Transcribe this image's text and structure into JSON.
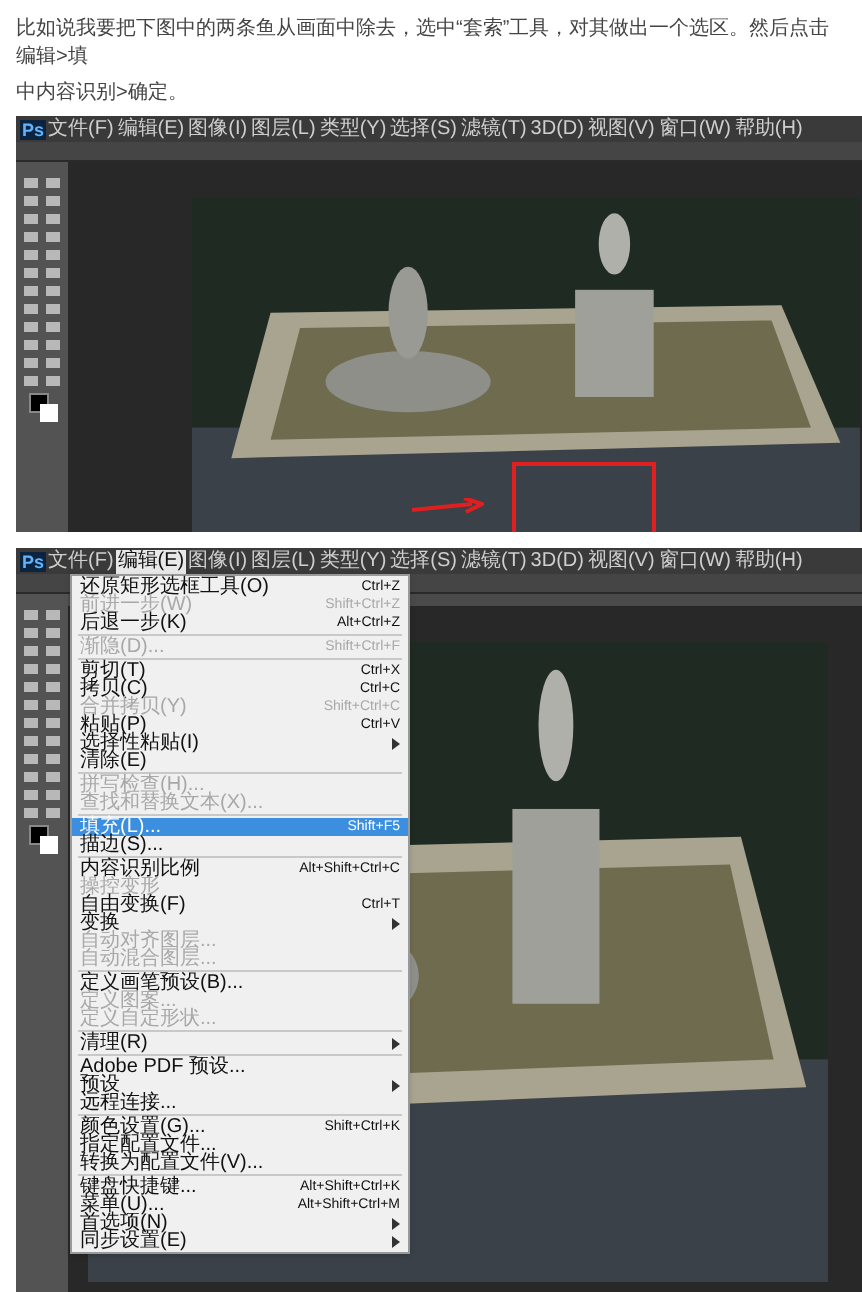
{
  "intro_lines": [
    "比如说我要把下图中的两条鱼从画面中除去，选中“套索”工具，对其做出一个选区。然后点击编辑>填",
    "中内容识别>确定。"
  ],
  "screenshots": [
    {
      "logo": "Ps",
      "menubar": [
        {
          "label": "文件(F)",
          "selected": false
        },
        {
          "label": "编辑(E)",
          "selected": false
        },
        {
          "label": "图像(I)",
          "selected": false
        },
        {
          "label": "图层(L)",
          "selected": false
        },
        {
          "label": "类型(Y)",
          "selected": false
        },
        {
          "label": "选择(S)",
          "selected": false
        },
        {
          "label": "滤镜(T)",
          "selected": false
        },
        {
          "label": "3D(D)",
          "selected": false
        },
        {
          "label": "视图(V)",
          "selected": false
        },
        {
          "label": "窗口(W)",
          "selected": false
        },
        {
          "label": "帮助(H)",
          "selected": false
        }
      ]
    },
    {
      "logo": "Ps",
      "menubar": [
        {
          "label": "文件(F)",
          "selected": false
        },
        {
          "label": "编辑(E)",
          "selected": true
        },
        {
          "label": "图像(I)",
          "selected": false
        },
        {
          "label": "图层(L)",
          "selected": false
        },
        {
          "label": "类型(Y)",
          "selected": false
        },
        {
          "label": "选择(S)",
          "selected": false
        },
        {
          "label": "滤镜(T)",
          "selected": false
        },
        {
          "label": "3D(D)",
          "selected": false
        },
        {
          "label": "视图(V)",
          "selected": false
        },
        {
          "label": "窗口(W)",
          "selected": false
        },
        {
          "label": "帮助(H)",
          "selected": false
        }
      ],
      "edit_menu": [
        {
          "items": [
            {
              "label": "还原矩形选框工具(O)",
              "shortcut": "Ctrl+Z",
              "disabled": false,
              "selected": false,
              "submenu": false
            },
            {
              "label": "前进一步(W)",
              "shortcut": "Shift+Ctrl+Z",
              "disabled": true,
              "selected": false,
              "submenu": false
            },
            {
              "label": "后退一步(K)",
              "shortcut": "Alt+Ctrl+Z",
              "disabled": false,
              "selected": false,
              "submenu": false
            }
          ]
        },
        {
          "items": [
            {
              "label": "渐隐(D)...",
              "shortcut": "Shift+Ctrl+F",
              "disabled": true,
              "selected": false,
              "submenu": false
            }
          ]
        },
        {
          "items": [
            {
              "label": "剪切(T)",
              "shortcut": "Ctrl+X",
              "disabled": false,
              "selected": false,
              "submenu": false
            },
            {
              "label": "拷贝(C)",
              "shortcut": "Ctrl+C",
              "disabled": false,
              "selected": false,
              "submenu": false
            },
            {
              "label": "合并拷贝(Y)",
              "shortcut": "Shift+Ctrl+C",
              "disabled": true,
              "selected": false,
              "submenu": false
            },
            {
              "label": "粘贴(P)",
              "shortcut": "Ctrl+V",
              "disabled": false,
              "selected": false,
              "submenu": false
            },
            {
              "label": "选择性粘贴(I)",
              "disabled": false,
              "selected": false,
              "submenu": true
            },
            {
              "label": "清除(E)",
              "disabled": false,
              "selected": false,
              "submenu": false
            }
          ]
        },
        {
          "items": [
            {
              "label": "拼写检查(H)...",
              "disabled": true,
              "selected": false,
              "submenu": false
            },
            {
              "label": "查找和替换文本(X)...",
              "disabled": true,
              "selected": false,
              "submenu": false
            }
          ]
        },
        {
          "items": [
            {
              "label": "填充(L)...",
              "shortcut": "Shift+F5",
              "disabled": false,
              "selected": true,
              "submenu": false
            },
            {
              "label": "描边(S)...",
              "disabled": false,
              "selected": false,
              "submenu": false
            }
          ]
        },
        {
          "items": [
            {
              "label": "内容识别比例",
              "shortcut": "Alt+Shift+Ctrl+C",
              "disabled": false,
              "selected": false,
              "submenu": false
            },
            {
              "label": "操控变形",
              "disabled": true,
              "selected": false,
              "submenu": false
            },
            {
              "label": "自由变换(F)",
              "shortcut": "Ctrl+T",
              "disabled": false,
              "selected": false,
              "submenu": false
            },
            {
              "label": "变换",
              "disabled": false,
              "selected": false,
              "submenu": true
            },
            {
              "label": "自动对齐图层...",
              "disabled": true,
              "selected": false,
              "submenu": false
            },
            {
              "label": "自动混合图层...",
              "disabled": true,
              "selected": false,
              "submenu": false
            }
          ]
        },
        {
          "items": [
            {
              "label": "定义画笔预设(B)...",
              "disabled": false,
              "selected": false,
              "submenu": false
            },
            {
              "label": "定义图案...",
              "disabled": true,
              "selected": false,
              "submenu": false
            },
            {
              "label": "定义自定形状...",
              "disabled": true,
              "selected": false,
              "submenu": false
            }
          ]
        },
        {
          "items": [
            {
              "label": "清理(R)",
              "disabled": false,
              "selected": false,
              "submenu": true
            }
          ]
        },
        {
          "items": [
            {
              "label": "Adobe PDF 预设...",
              "disabled": false,
              "selected": false,
              "submenu": false
            },
            {
              "label": "预设",
              "disabled": false,
              "selected": false,
              "submenu": true
            },
            {
              "label": "远程连接...",
              "disabled": false,
              "selected": false,
              "submenu": false
            }
          ]
        },
        {
          "items": [
            {
              "label": "颜色设置(G)...",
              "shortcut": "Shift+Ctrl+K",
              "disabled": false,
              "selected": false,
              "submenu": false
            },
            {
              "label": "指定配置文件...",
              "disabled": false,
              "selected": false,
              "submenu": false
            },
            {
              "label": "转换为配置文件(V)...",
              "disabled": false,
              "selected": false,
              "submenu": false
            }
          ]
        },
        {
          "items": [
            {
              "label": "键盘快捷键...",
              "shortcut": "Alt+Shift+Ctrl+K",
              "disabled": false,
              "selected": false,
              "submenu": false
            },
            {
              "label": "菜单(U)...",
              "shortcut": "Alt+Shift+Ctrl+M",
              "disabled": false,
              "selected": false,
              "submenu": false
            },
            {
              "label": "首选项(N)",
              "disabled": false,
              "selected": false,
              "submenu": true
            },
            {
              "label": "同步设置(E)",
              "disabled": false,
              "selected": false,
              "submenu": true
            }
          ]
        }
      ]
    }
  ]
}
